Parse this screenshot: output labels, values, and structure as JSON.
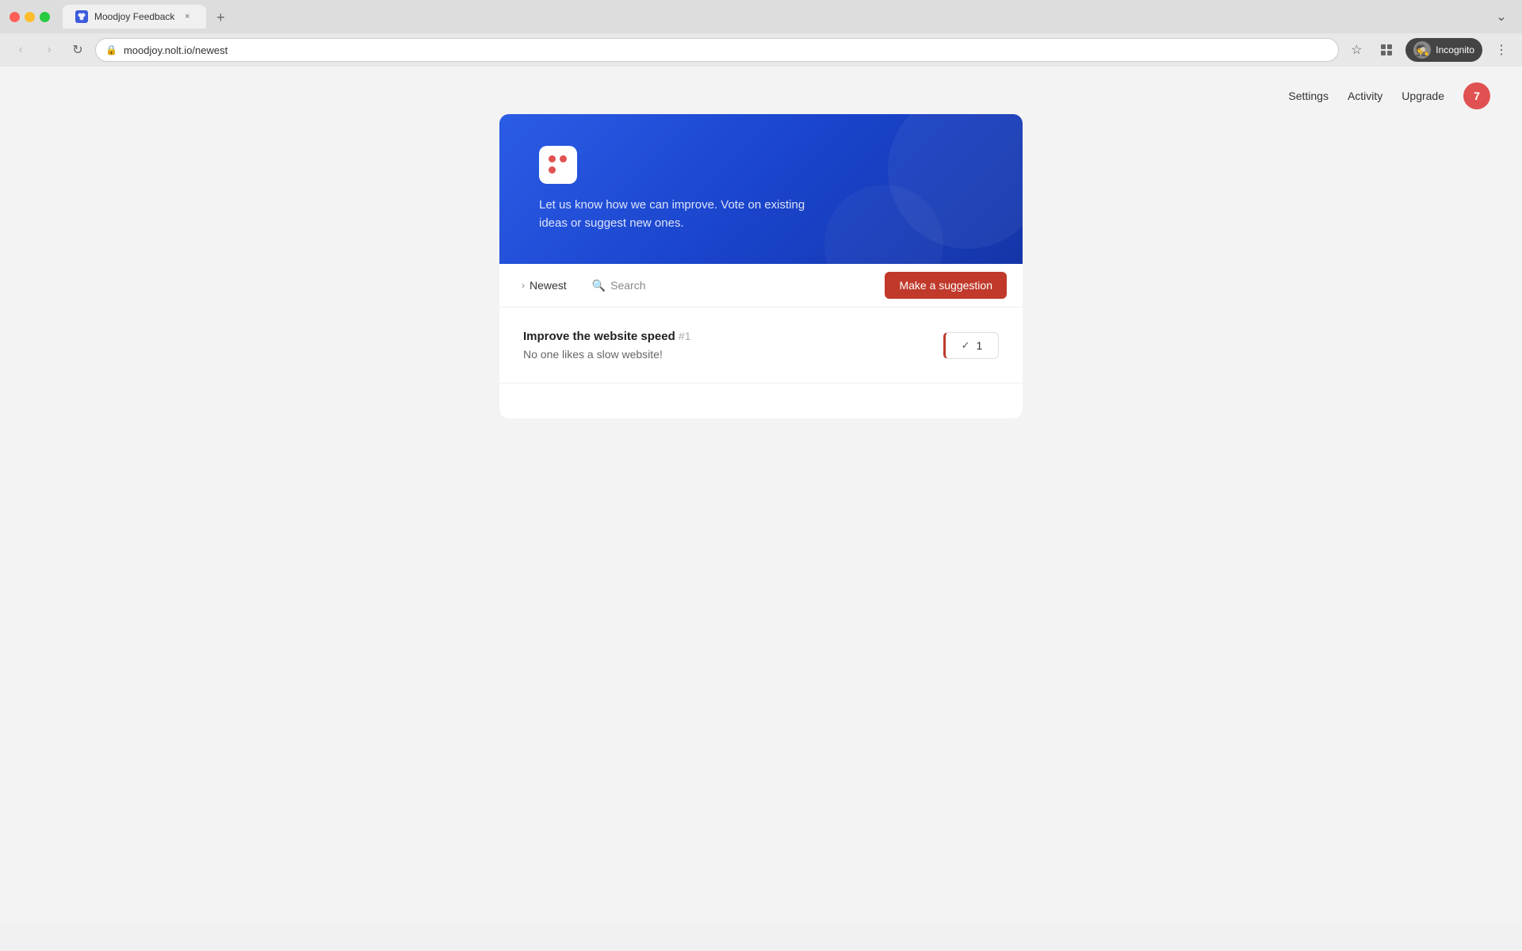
{
  "browser": {
    "tab_title": "Moodjoy Feedback",
    "tab_close": "×",
    "tab_new": "+",
    "address": "moodjoy.nolt.io/newest",
    "back_icon": "‹",
    "forward_icon": "›",
    "reload_icon": "↻",
    "bookmark_icon": "☆",
    "extensions_icon": "⊡",
    "incognito_label": "Incognito",
    "menu_icon": "⋮",
    "chevron_down": "⌄"
  },
  "nav": {
    "settings": "Settings",
    "activity": "Activity",
    "upgrade": "Upgrade",
    "user_badge": "7"
  },
  "hero": {
    "description": "Let us know how we can improve. Vote on existing ideas or suggest new ones."
  },
  "filter_bar": {
    "sort_label": "Newest",
    "search_placeholder": "Search",
    "suggestion_button": "Make a suggestion"
  },
  "feedback_items": [
    {
      "title": "Improve the website speed",
      "id": "#1",
      "description": "No one likes a slow website!",
      "votes": "1"
    }
  ]
}
